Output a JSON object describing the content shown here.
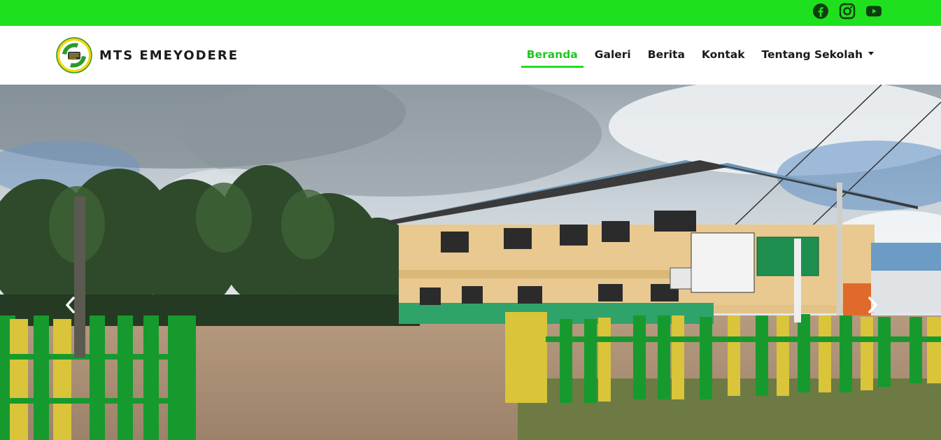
{
  "colors": {
    "accent": "#1fe01f",
    "active_text": "#1fc81f",
    "text": "#1a1a1a",
    "icon": "#0f3d0f"
  },
  "social": [
    {
      "name": "facebook-icon"
    },
    {
      "name": "instagram-icon"
    },
    {
      "name": "youtube-icon"
    }
  ],
  "brand": {
    "name": "MTS EMEYODERE"
  },
  "nav": {
    "items": [
      {
        "label": "Beranda",
        "active": true
      },
      {
        "label": "Galeri"
      },
      {
        "label": "Berita"
      },
      {
        "label": "Kontak"
      },
      {
        "label": "Tentang Sekolah",
        "dropdown": true
      }
    ]
  },
  "hero": {
    "prev_icon": "chevron-left-icon",
    "next_icon": "chevron-right-icon"
  }
}
